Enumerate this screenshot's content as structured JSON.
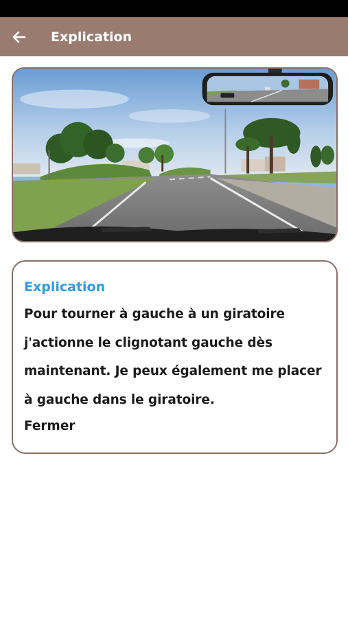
{
  "header": {
    "title": "Explication",
    "back_icon": "arrow-left-icon",
    "background_color": "#9a7b70"
  },
  "photo": {
    "subject": "roundabout-approach-dashcam"
  },
  "explanation": {
    "heading": "Explication",
    "heading_color": "#2d9be3",
    "body": "Pour tourner à gauche à un giratoire j'actionne le clignotant gauche dès maintenant. Je peux également me placer à gauche dans le giratoire.",
    "close_label": "Fermer"
  }
}
